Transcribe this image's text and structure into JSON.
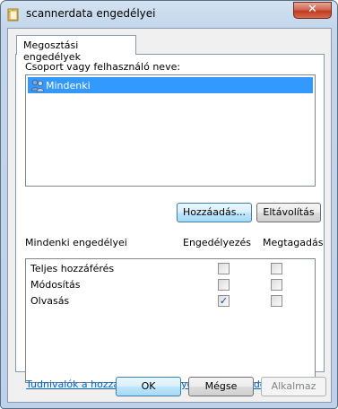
{
  "window": {
    "title": "scannerdata engedélyei",
    "close_glyph": "✕"
  },
  "tab": {
    "label": "Megosztási engedélyek"
  },
  "group_label": "Csoport vagy felhasználó neve:",
  "users": [
    {
      "name": "Mindenki",
      "selected": true
    }
  ],
  "buttons": {
    "add": "Hozzáadás...",
    "remove": "Eltávolítás",
    "ok": "OK",
    "cancel": "Mégse",
    "apply": "Alkalmaz"
  },
  "permissions": {
    "header": "Mindenki engedélyei",
    "allow_header": "Engedélyezés",
    "deny_header": "Megtagadás",
    "rows": [
      {
        "name": "Teljes hozzáférés",
        "allow": false,
        "deny": false
      },
      {
        "name": "Módosítás",
        "allow": false,
        "deny": false
      },
      {
        "name": "Olvasás",
        "allow": true,
        "deny": false
      }
    ]
  },
  "help_link": "Tudnivalók a hozzáférési szabályokról és engedélyekről",
  "icons": {
    "title": "folder-icon",
    "user": "users-group-icon",
    "check": "✓"
  }
}
